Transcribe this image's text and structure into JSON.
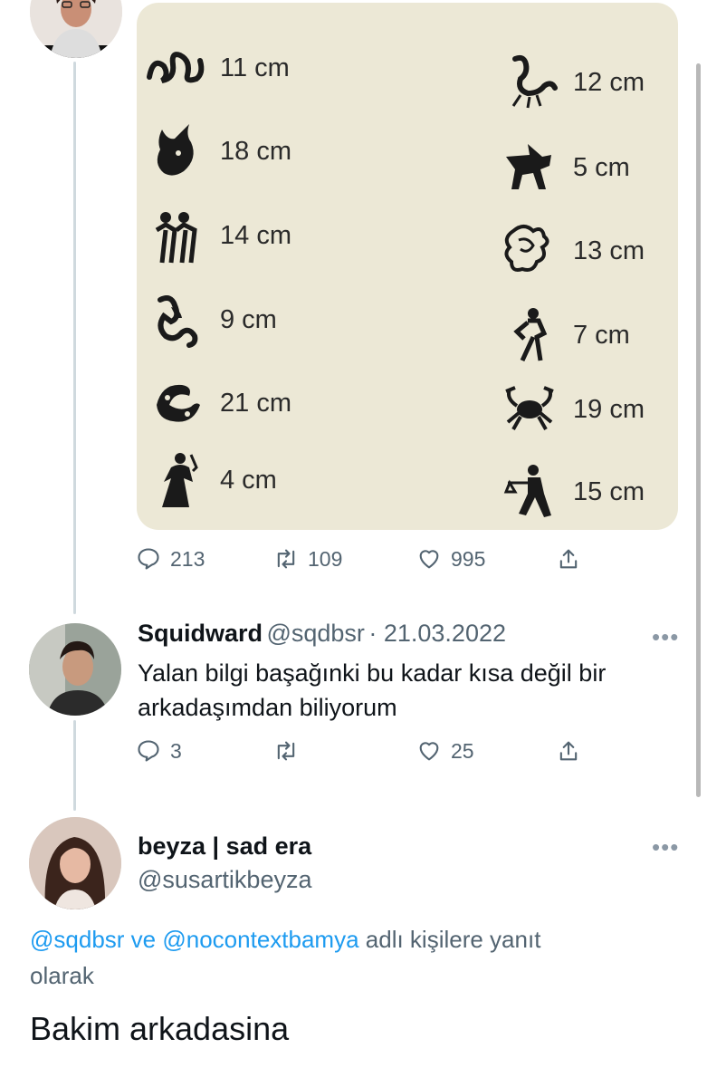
{
  "photo_rows": {
    "left": [
      {
        "sign": "aries-icon",
        "measure": "11 cm"
      },
      {
        "sign": "taurus-icon",
        "measure": "18 cm"
      },
      {
        "sign": "gemini-icon",
        "measure": "14 cm"
      },
      {
        "sign": "capricorn-icon",
        "measure": "9 cm"
      },
      {
        "sign": "pisces-icon",
        "measure": "21 cm"
      },
      {
        "sign": "virgo-icon",
        "measure": "4 cm"
      }
    ],
    "right": [
      {
        "sign": "scorpio-icon",
        "measure": "12 cm"
      },
      {
        "sign": "sagittarius-icon",
        "measure": "5 cm"
      },
      {
        "sign": "leo-icon",
        "measure": "13 cm"
      },
      {
        "sign": "aquarius-icon",
        "measure": "7 cm"
      },
      {
        "sign": "cancer-icon",
        "measure": "19 cm"
      },
      {
        "sign": "libra-icon",
        "measure": "15 cm"
      }
    ]
  },
  "tweet1": {
    "replies": "213",
    "retweets": "109",
    "likes": "995"
  },
  "tweet2": {
    "name": "Squidward",
    "handle": "@sqdbsr",
    "date": "· 21.03.2022",
    "text_line1": "Yalan bilgi başağınki bu kadar kısa değil bir",
    "text_line2": "arkadaşımdan biliyorum",
    "replies": "3",
    "retweets": "",
    "likes": "25",
    "more": "•••"
  },
  "tweet3": {
    "name": "beyza | sad era",
    "handle": "@susartikbeyza",
    "more": "•••",
    "reply_mention1": "@sqdbsr",
    "reply_ve": " ve ",
    "reply_mention2": "@nocontextbamya",
    "reply_suffix": " adlı kişilere yanıt",
    "reply_line2": "olarak",
    "text": "Bakim arkadasina"
  },
  "colors": {
    "accent": "#1d9bf0",
    "muted": "#536471",
    "thread_line": "#cfd9de",
    "photo_bg": "#ece8d6"
  }
}
